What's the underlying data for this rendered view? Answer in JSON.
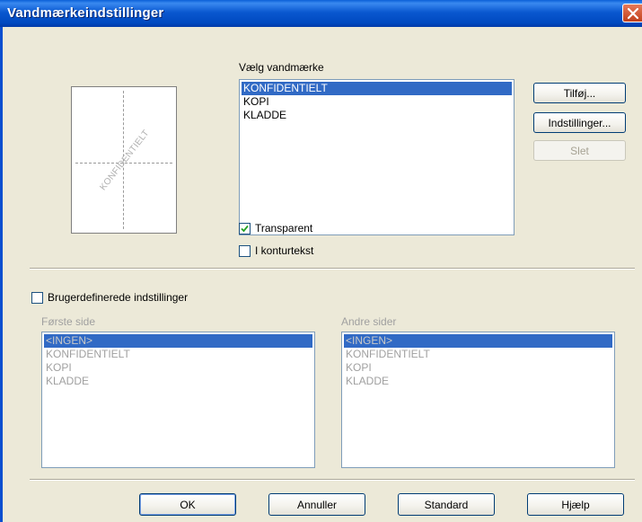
{
  "window": {
    "title": "Vandmærkeindstillinger"
  },
  "preview": {
    "watermark_text": "KONFIDENTIELT"
  },
  "select_watermark": {
    "label": "Vælg vandmærke",
    "items": [
      {
        "label": "KONFIDENTIELT",
        "selected": true
      },
      {
        "label": "KOPI",
        "selected": false
      },
      {
        "label": "KLADDE",
        "selected": false
      }
    ]
  },
  "buttons": {
    "add": "Tilføj...",
    "settings": "Indstillinger...",
    "delete": "Slet"
  },
  "options": {
    "transparent": {
      "label": "Transparent",
      "checked": true
    },
    "outline": {
      "label": "I konturtekst",
      "checked": false
    }
  },
  "custom": {
    "label": "Brugerdefinerede indstillinger",
    "checked": false,
    "first_page": {
      "label": "Første side",
      "items": [
        {
          "label": "<INGEN>",
          "selected": true
        },
        {
          "label": "KONFIDENTIELT",
          "selected": false
        },
        {
          "label": "KOPI",
          "selected": false
        },
        {
          "label": "KLADDE",
          "selected": false
        }
      ]
    },
    "other_pages": {
      "label": "Andre sider",
      "items": [
        {
          "label": "<INGEN>",
          "selected": true
        },
        {
          "label": "KONFIDENTIELT",
          "selected": false
        },
        {
          "label": "KOPI",
          "selected": false
        },
        {
          "label": "KLADDE",
          "selected": false
        }
      ]
    }
  },
  "footer": {
    "ok": "OK",
    "cancel": "Annuller",
    "default": "Standard",
    "help": "Hjælp"
  },
  "icons": {
    "close": "close-icon",
    "check": "checkmark-icon"
  },
  "colors": {
    "titlebar": "#0a58d0",
    "selection": "#316ac5",
    "dialog_bg": "#ece9d8",
    "close_button": "#c0401c"
  }
}
